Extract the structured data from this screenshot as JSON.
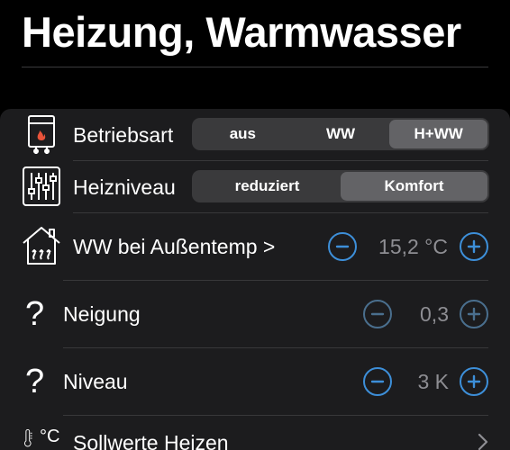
{
  "header": {
    "title": "Heizung, Warmwasser"
  },
  "colors": {
    "background": "#000000",
    "panel": "#1c1c1e",
    "segment_bg": "#3a3a3c",
    "segment_selected": "#636366",
    "stepper_accent": "#3d8fd9",
    "value_text": "#8e8e93"
  },
  "rows": {
    "betriebsart": {
      "icon": "boiler-icon",
      "label": "Betriebsart",
      "options": [
        "aus",
        "WW",
        "H+WW"
      ],
      "selected": "H+WW"
    },
    "heizniveau": {
      "icon": "sliders-icon",
      "label": "Heizniveau",
      "options": [
        "reduziert",
        "Komfort"
      ],
      "selected": "Komfort"
    },
    "ww_aussentemp": {
      "icon": "house-heat-icon",
      "label": "WW bei Außentemp >",
      "value": "15,2 °C",
      "minus": "minus-icon",
      "plus": "plus-icon"
    },
    "neigung": {
      "icon": "question-icon",
      "icon_glyph": "?",
      "label": "Neigung",
      "value": "0,3"
    },
    "niveau": {
      "icon": "question-icon",
      "icon_glyph": "?",
      "label": "Niveau",
      "value": "3 K"
    },
    "sollwerte": {
      "icon": "thermometer-celsius-icon",
      "icon_glyph": "°C",
      "label": "Sollwerte Heizen"
    }
  }
}
